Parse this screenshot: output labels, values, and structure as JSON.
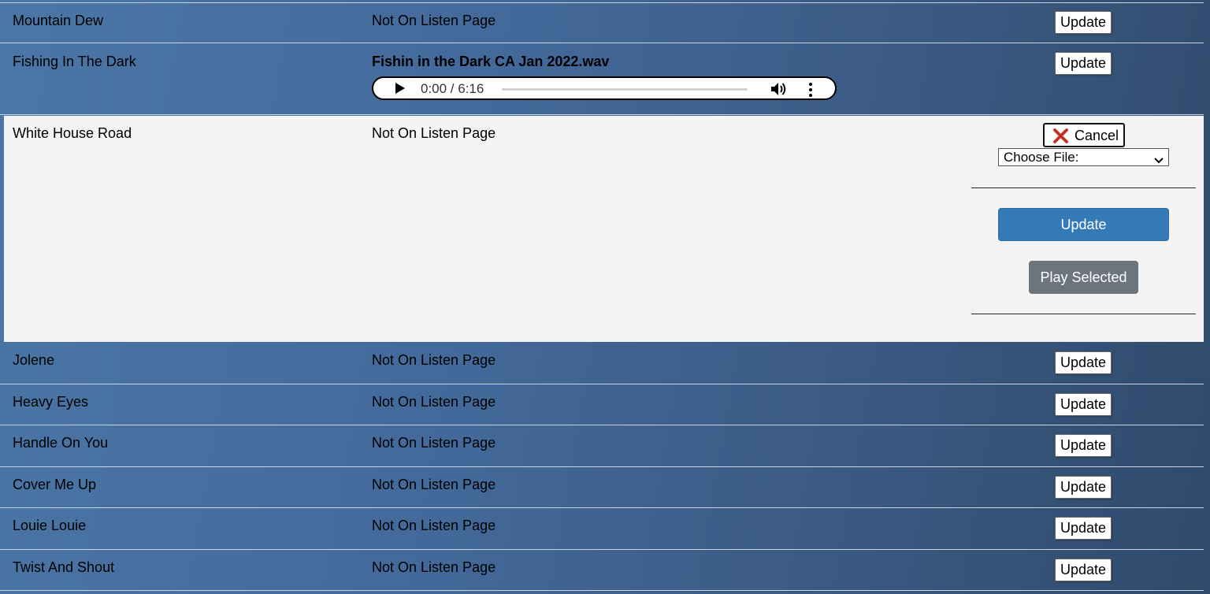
{
  "rows_top": [
    {
      "title": "Mountain Dew",
      "status": "Not On Listen Page",
      "button": "Update"
    },
    {
      "title": "Fishing In The Dark",
      "file_name": "Fishin in the Dark CA Jan 2022.wav",
      "button": "Update"
    }
  ],
  "audio_player": {
    "time": "0:00 / 6:16",
    "progress": 0
  },
  "expanded_row": {
    "title": "White House Road",
    "status": "Not On Listen Page",
    "cancel_label": "Cancel",
    "select_value": "Choose File:",
    "update_label": "Update",
    "play_selected_label": "Play Selected"
  },
  "rows_bottom": [
    {
      "title": "Jolene",
      "status": "Not On Listen Page",
      "button": "Update"
    },
    {
      "title": "Heavy Eyes",
      "status": "Not On Listen Page",
      "button": "Update"
    },
    {
      "title": "Handle On You",
      "status": "Not On Listen Page",
      "button": "Update"
    },
    {
      "title": "Cover Me Up",
      "status": "Not On Listen Page",
      "button": "Update"
    },
    {
      "title": "Louie Louie",
      "status": "Not On Listen Page",
      "button": "Update"
    },
    {
      "title": "Twist And Shout",
      "status": "Not On Listen Page",
      "button": "Update"
    }
  ],
  "colors": {
    "primary_button": "#337ab7",
    "secondary_button": "#6c757d",
    "cancel_icon": "#d43a2a",
    "expanded_background": "#f4f4f4"
  },
  "icons": [
    "play-icon",
    "volume-icon",
    "more-options-icon",
    "close-x-icon",
    "chevron-down-icon"
  ]
}
